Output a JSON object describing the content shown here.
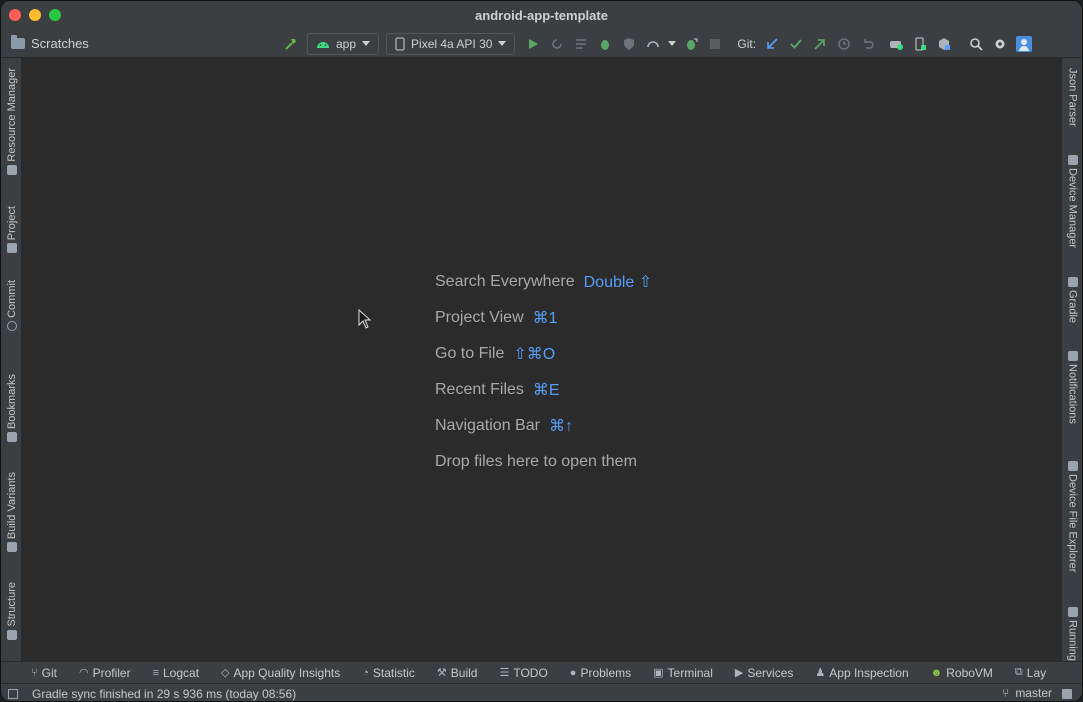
{
  "window": {
    "title": "android-app-template"
  },
  "toolbar": {
    "project_label": "Scratches",
    "run_config": "app",
    "device": "Pixel 4a API 30",
    "git_label": "Git:"
  },
  "left_tabs": [
    {
      "label": "Resource Manager"
    },
    {
      "label": "Project"
    },
    {
      "label": "Commit"
    },
    {
      "label": "Bookmarks"
    },
    {
      "label": "Build Variants"
    },
    {
      "label": "Structure"
    }
  ],
  "right_tabs": [
    {
      "label": "Json Parser"
    },
    {
      "label": "Device Manager"
    },
    {
      "label": "Gradle"
    },
    {
      "label": "Notifications"
    },
    {
      "label": "Device File Explorer"
    },
    {
      "label": "Running"
    }
  ],
  "editor": {
    "hints": [
      {
        "label": "Search Everywhere",
        "key": "Double ⇧"
      },
      {
        "label": "Project View",
        "key": "⌘1"
      },
      {
        "label": "Go to File",
        "key": "⇧⌘O"
      },
      {
        "label": "Recent Files",
        "key": "⌘E"
      },
      {
        "label": "Navigation Bar",
        "key": "⌘↑"
      },
      {
        "label": "Drop files here to open them",
        "key": ""
      }
    ]
  },
  "bottom_tabs": [
    {
      "label": "Git"
    },
    {
      "label": "Profiler"
    },
    {
      "label": "Logcat"
    },
    {
      "label": "App Quality Insights"
    },
    {
      "label": "Statistic"
    },
    {
      "label": "Build"
    },
    {
      "label": "TODO"
    },
    {
      "label": "Problems"
    },
    {
      "label": "Terminal"
    },
    {
      "label": "Services"
    },
    {
      "label": "App Inspection"
    },
    {
      "label": "RoboVM"
    },
    {
      "label": "Lay"
    }
  ],
  "status": {
    "message": "Gradle sync finished in 29 s 936 ms (today 08:56)",
    "branch": "master"
  }
}
